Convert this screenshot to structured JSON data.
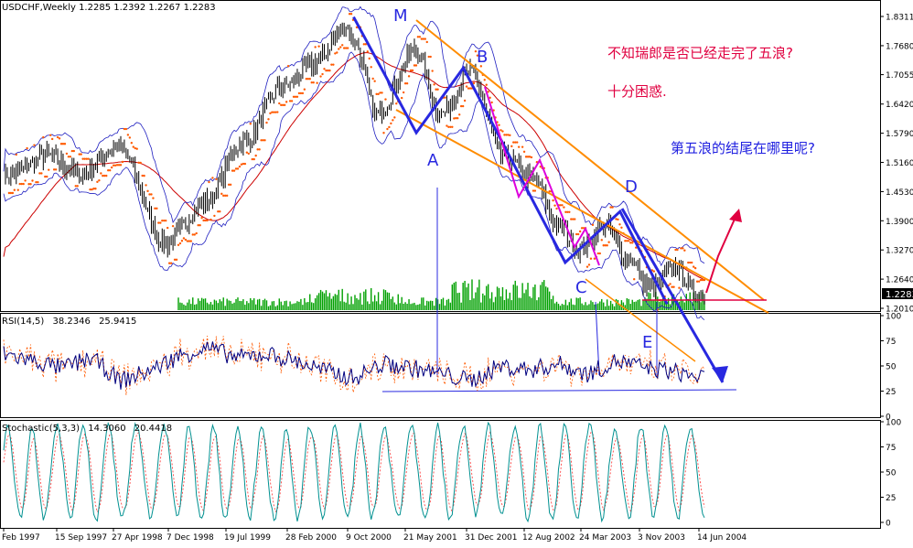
{
  "window": {
    "symbol_line": "USDCHF,Weekly  1.2285 1.2392 1.2267 1.2283"
  },
  "annotations": {
    "note1": "不知瑞郎是否已经走完了五浪?",
    "note2": "十分困惑.",
    "note3": "第五浪的结尾在哪里呢?",
    "wave_labels": [
      "M",
      "A",
      "B",
      "C",
      "D",
      "E"
    ]
  },
  "colors": {
    "candles": "#000000",
    "bollinger": "#2020c0",
    "moving_average": "#cc0000",
    "parabolic_sar": "#ff5a00",
    "channel": "#ff8c00",
    "wave_lines": "#2828e0",
    "wave_highlight": "#dd00dd",
    "volume": "#00a000",
    "note_red": "#e00040",
    "note_blue": "#2020e0",
    "rsi_line": "#000080",
    "rsi_signal": "#ff5a00",
    "stoch_main": "#009090",
    "stoch_signal": "#ff3030"
  },
  "chart_data": [
    {
      "type": "line",
      "title": "USDCHF,Weekly",
      "ohlc_last": {
        "open": 1.2285,
        "high": 1.2392,
        "low": 1.2267,
        "close": 1.2283
      },
      "current_price_label": "1.2283",
      "y_ticks": [
        "1.8311",
        "1.7680",
        "1.7055",
        "1.6420",
        "1.5790",
        "1.5160",
        "1.4530",
        "1.3900",
        "1.3270",
        "1.2640",
        "1.2010"
      ],
      "x_ticks": [
        "Feb 1997",
        "15 Sep 1997",
        "27 Apr 1998",
        "7 Dec 1998",
        "19 Jul 1999",
        "28 Feb 2000",
        "9 Oct 2000",
        "21 May 2001",
        "31 Dec 2001",
        "12 Aug 2002",
        "24 Mar 2003",
        "3 Nov 2003",
        "14 Jun 2004"
      ],
      "x": [
        "1997-02",
        "1997-07",
        "1997-11",
        "1998-04",
        "1998-10",
        "1999-03",
        "1999-08",
        "2000-01",
        "2000-05",
        "2000-09",
        "2000-10",
        "2001-01",
        "2001-06",
        "2001-09",
        "2002-01",
        "2002-05",
        "2002-09",
        "2002-12",
        "2003-03",
        "2003-06",
        "2003-09",
        "2003-12",
        "2004-03",
        "2004-06"
      ],
      "series": [
        {
          "values": [
            1.49,
            1.53,
            1.49,
            1.55,
            1.34,
            1.43,
            1.56,
            1.68,
            1.73,
            1.81,
            1.78,
            1.62,
            1.76,
            1.62,
            1.71,
            1.53,
            1.48,
            1.38,
            1.33,
            1.38,
            1.31,
            1.24,
            1.29,
            1.23
          ]
        }
      ],
      "wave_points": [
        {
          "label": "M",
          "date": "2000-10",
          "price": 1.83
        },
        {
          "label": "A",
          "date": "2001-06",
          "price": 1.58
        },
        {
          "label": "B",
          "date": "2001-12",
          "price": 1.72
        },
        {
          "label": "C",
          "date": "2003-01",
          "price": 1.3
        },
        {
          "label": "D",
          "date": "2003-08",
          "price": 1.41
        },
        {
          "label": "E",
          "date": "2004-02",
          "price": 1.21
        }
      ],
      "ylim": [
        1.18,
        1.84
      ]
    },
    {
      "type": "line",
      "title": "RSI(14,5)",
      "header_values": [
        "38.2346",
        "25.9415"
      ],
      "y_ticks": [
        "100",
        "75",
        "50",
        "25",
        "0"
      ],
      "ylim": [
        0,
        100
      ],
      "series": [
        {
          "values": [
            62,
            55,
            48,
            58,
            35,
            45,
            60,
            68,
            58,
            62,
            55,
            45,
            38,
            52,
            48,
            42,
            35,
            50,
            46,
            52,
            42,
            55,
            48,
            44,
            38
          ]
        }
      ]
    },
    {
      "type": "line",
      "title": "Stochastic(5,3,3)",
      "header_values": [
        "14.3060",
        "20.4418"
      ],
      "y_ticks": [
        "100",
        "75",
        "50",
        "25",
        "0"
      ],
      "ylim": [
        0,
        100
      ]
    }
  ]
}
